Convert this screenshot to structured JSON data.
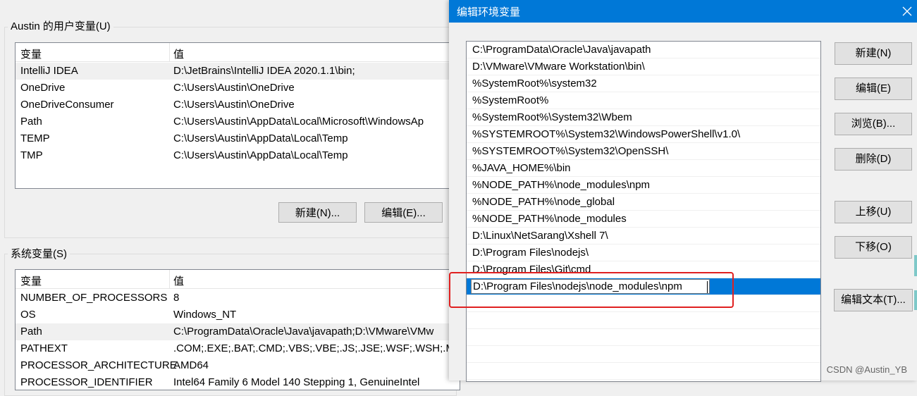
{
  "user_vars": {
    "group_title": "Austin 的用户变量(U)",
    "col_var": "变量",
    "col_val": "值",
    "rows": [
      {
        "name": "IntelliJ IDEA",
        "value": "D:\\JetBrains\\IntelliJ IDEA 2020.1.1\\bin;"
      },
      {
        "name": "OneDrive",
        "value": "C:\\Users\\Austin\\OneDrive"
      },
      {
        "name": "OneDriveConsumer",
        "value": "C:\\Users\\Austin\\OneDrive"
      },
      {
        "name": "Path",
        "value": "C:\\Users\\Austin\\AppData\\Local\\Microsoft\\WindowsAp"
      },
      {
        "name": "TEMP",
        "value": "C:\\Users\\Austin\\AppData\\Local\\Temp"
      },
      {
        "name": "TMP",
        "value": "C:\\Users\\Austin\\AppData\\Local\\Temp"
      }
    ],
    "new_button": "新建(N)...",
    "edit_button": "编辑(E)..."
  },
  "system_vars": {
    "group_title": "系统变量(S)",
    "col_var": "变量",
    "col_val": "值",
    "rows": [
      {
        "name": "NUMBER_OF_PROCESSORS",
        "value": "8"
      },
      {
        "name": "OS",
        "value": "Windows_NT"
      },
      {
        "name": "Path",
        "value": "C:\\ProgramData\\Oracle\\Java\\javapath;D:\\VMware\\VMw"
      },
      {
        "name": "PATHEXT",
        "value": ".COM;.EXE;.BAT;.CMD;.VBS;.VBE;.JS;.JSE;.WSF;.WSH;.MS"
      },
      {
        "name": "PROCESSOR_ARCHITECTURE",
        "value": "AMD64"
      },
      {
        "name": "PROCESSOR_IDENTIFIER",
        "value": "Intel64 Family 6 Model 140 Stepping 1, GenuineIntel"
      }
    ]
  },
  "edit_dialog": {
    "title": "编辑环境变量",
    "entries": [
      "C:\\ProgramData\\Oracle\\Java\\javapath",
      "D:\\VMware\\VMware Workstation\\bin\\",
      "%SystemRoot%\\system32",
      "%SystemRoot%",
      "%SystemRoot%\\System32\\Wbem",
      "%SYSTEMROOT%\\System32\\WindowsPowerShell\\v1.0\\",
      "%SYSTEMROOT%\\System32\\OpenSSH\\",
      "%JAVA_HOME%\\bin",
      "%NODE_PATH%\\node_modules\\npm",
      "%NODE_PATH%\\node_global",
      "%NODE_PATH%\\node_modules",
      "D:\\Linux\\NetSarang\\Xshell 7\\",
      "D:\\Program Files\\nodejs\\",
      "D:\\Program Files\\Git\\cmd"
    ],
    "editing_value": "D:\\Program Files\\nodejs\\node_modules\\npm",
    "buttons": {
      "new": "新建(N)",
      "edit": "编辑(E)",
      "browse": "浏览(B)...",
      "delete": "删除(D)",
      "move_up": "上移(U)",
      "move_down": "下移(O)",
      "edit_text": "编辑文本(T)..."
    }
  },
  "watermark": "CSDN @Austin_YB",
  "colors": {
    "title_bar": "#0078d7",
    "selection": "#0078d7",
    "highlight_box": "#e02020"
  }
}
